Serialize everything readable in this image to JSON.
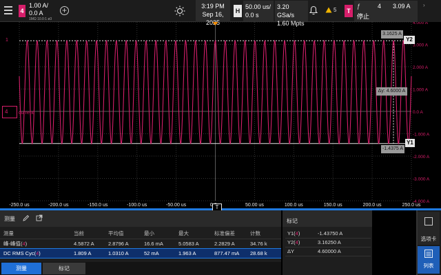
{
  "topbar": {
    "channel_badge": "4",
    "channel_scale": "1.00 A/",
    "channel_offset": "0.0 A",
    "channel_extra": "1MΩ   10.0:1  ø3",
    "add_label": "+",
    "clock_time": "3:19 PM",
    "clock_date": "Sep 16, 2025",
    "horizontal_badge": "H",
    "horizontal_scale": "50.00 us/",
    "horizontal_delay": "0.0 s",
    "sample_rate": "3.20 GSa/s",
    "memory_depth": "1.60 Mpts",
    "notification_count": "5",
    "trigger_badge": "T",
    "trigger_edge_symbol": "ƒ",
    "trigger_source": "4",
    "trigger_level": "3.09 A",
    "trigger_status": "停止"
  },
  "scope": {
    "trace_label": "current",
    "ch4_marker": "4",
    "ch1_marker": "1",
    "trigger_time_marker": "T",
    "y_ticks": [
      "4.000 A",
      "3.000 A",
      "2.000 A",
      "1.000 A",
      "0.0 A",
      "-1.000 A",
      "-2.000 A",
      "-3.000 A",
      "-4.000 A"
    ],
    "x_ticks": [
      "-250.0 us",
      "-200.0 us",
      "-150.0 us",
      "-100.0 us",
      "-50.00 us",
      "0.0 s",
      "50.00 us",
      "100.0 us",
      "150.0 us",
      "200.0 us",
      "250.0 us"
    ],
    "cursor_y2_value": "3.1625 A",
    "cursor_y2_tag": "Y2",
    "cursor_delta_value": "Δy: 4.6000 A",
    "cursor_y1_value": "-1.4375 A",
    "cursor_y1_tag": "Y1",
    "trace_color": "#d61e6a"
  },
  "measurements": {
    "title": "测量",
    "headers": [
      "测量",
      "当前",
      "平均值",
      "最小",
      "最大",
      "标准偏差",
      "计数"
    ],
    "rows": [
      {
        "name": "峰-峰值(",
        "ch": "4",
        "close": ")",
        "current": "4.5872 A",
        "mean": "2.8796 A",
        "min": "16.6 mA",
        "max": "5.0583 A",
        "std": "2.2829 A",
        "count": "34.76 k"
      },
      {
        "name": "DC RMS Cyc(",
        "ch": "4",
        "close": ")",
        "current": "1.809 A",
        "mean": "1.0310 A",
        "min": "52 mA",
        "max": "1.963 A",
        "std": "877.47 mA",
        "count": "28.68 k"
      }
    ],
    "tab_active": "测量",
    "tab_inactive": "标记"
  },
  "markers_panel": {
    "title": "标记",
    "rows": [
      {
        "label": "Y1(",
        "ch": "4",
        "close": ")",
        "value": "-1.43750 A"
      },
      {
        "label": "Y2(",
        "ch": "4",
        "close": ")",
        "value": "3.16250 A"
      },
      {
        "label": "ΔY",
        "ch": "",
        "close": "",
        "value": "4.60000 A"
      }
    ]
  },
  "side_panel": {
    "card_label": "选项卡",
    "list_label": "列表"
  },
  "chart_data": {
    "type": "line",
    "series": [
      {
        "waveform": "sine",
        "frequency_hz": 79200,
        "amplitude_peak_A": 2.3,
        "offset_A": 0.86,
        "x_start_us": -250,
        "x_end_us": 250
      }
    ],
    "xlim": [
      -250,
      250
    ],
    "ylim": [
      -4,
      4
    ],
    "grid": true
  }
}
